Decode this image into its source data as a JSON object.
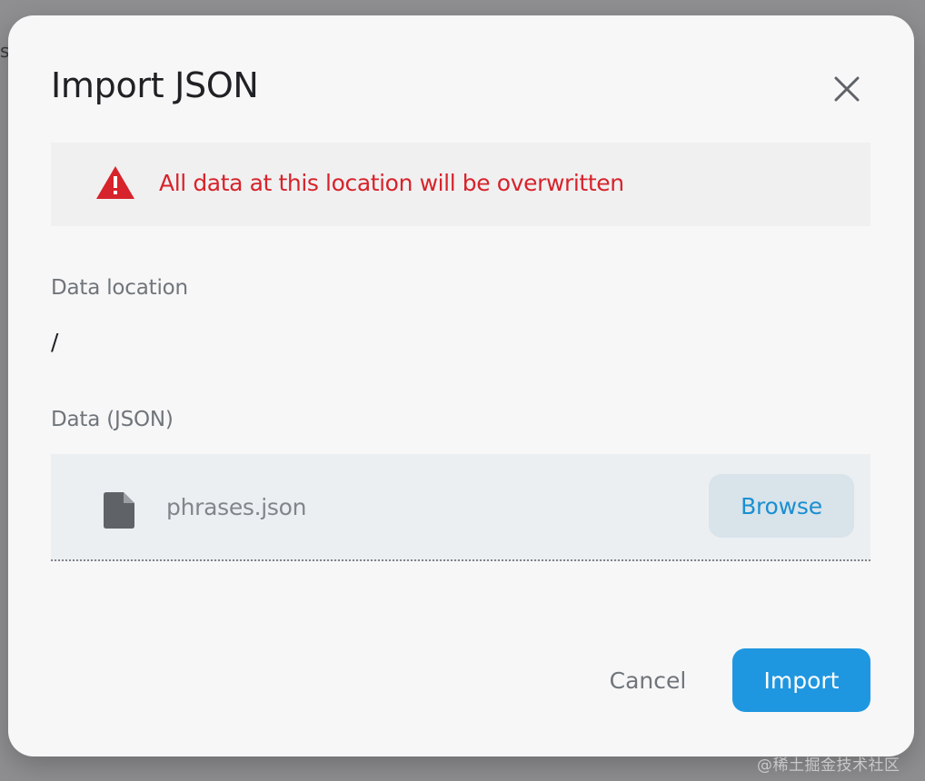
{
  "backdrop": {
    "peek_text": "s"
  },
  "dialog": {
    "title": "Import JSON",
    "close_icon": "close-icon",
    "warning": {
      "icon": "warning-icon",
      "message": "All data at this location will be overwritten",
      "color": "#d7232b"
    },
    "location": {
      "label": "Data location",
      "value": "/"
    },
    "data_field": {
      "label": "Data (JSON)",
      "file_icon": "file-icon",
      "file_name": "phrases.json",
      "browse_label": "Browse"
    },
    "actions": {
      "cancel_label": "Cancel",
      "import_label": "Import",
      "accent_color": "#1f97e0"
    }
  },
  "watermark": "@稀土掘金技术社区"
}
